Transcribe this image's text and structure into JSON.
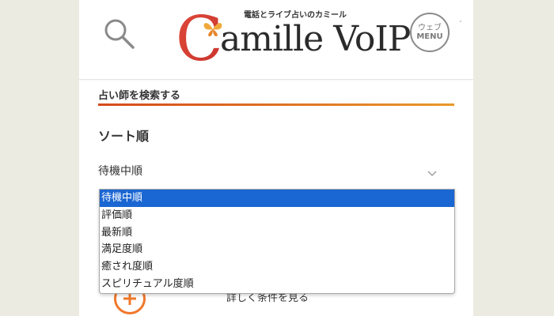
{
  "header": {
    "logo_tagline": "電話とライブ占いのカミール",
    "logo_initial": "C",
    "logo_word": "amille VoIP",
    "menu_line1": "ウェブ",
    "menu_line2": "MENU",
    "icons": {
      "search": "search-icon",
      "logo_butterfly": "butterfly-icon"
    }
  },
  "colors": {
    "accent_start": "#d44a1c",
    "accent_end": "#e8982a",
    "selected_option": "#1a66d2",
    "plus_icon": "#f0782a"
  },
  "search": {
    "section_title": "占い師を検索する",
    "sort_label": "ソート順",
    "sort_value": "待機中順"
  },
  "dropdown": {
    "options": [
      "待機中順",
      "評価順",
      "最新順",
      "満足度順",
      "癒され度順",
      "スピリチュアル度順"
    ],
    "selected_index": 0
  },
  "filter": {
    "label": "詳しく条件を見る"
  }
}
